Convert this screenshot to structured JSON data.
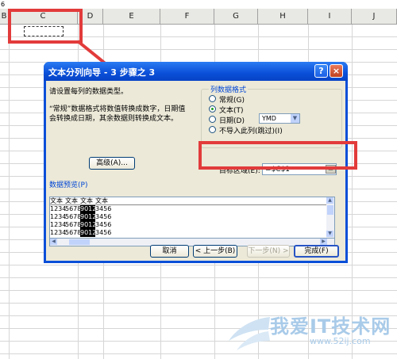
{
  "sheet": {
    "row_number": "6",
    "columns": [
      "B",
      "C",
      "D",
      "E",
      "F",
      "G",
      "H",
      "I",
      "J"
    ]
  },
  "dialog": {
    "title": "文本分列向导 - 3 步骤之 3",
    "help_label": "?",
    "close_label": "×",
    "prompt": "请设置每列的数据类型。",
    "description_line1": "“常规”数据格式将数值转换成数字，日期值",
    "description_line2": "会转换成日期，其余数据则转换成文本。",
    "advanced_button": "高级(A)...",
    "column_format": {
      "title": "列数据格式",
      "options": [
        {
          "label": "常规(G)",
          "selected": false
        },
        {
          "label": "文本(T)",
          "selected": true
        },
        {
          "label": "日期(D)",
          "selected": false
        },
        {
          "label": "不导入此列(跳过)(I)",
          "selected": false
        }
      ],
      "date_format": "YMD"
    },
    "destination": {
      "label": "目标区域(E):",
      "value": "=$C$1"
    },
    "preview": {
      "title": "数据预览(P)",
      "header_cells": [
        "文本",
        "文本",
        "文本",
        "文本"
      ],
      "rows": [
        [
          "1234",
          "5678",
          "9012",
          "3456"
        ],
        [
          "1234",
          "5678",
          "9012",
          "3456"
        ],
        [
          "1234",
          "5678",
          "9012",
          "3456"
        ],
        [
          "1234",
          "5678",
          "9012",
          "3456"
        ]
      ]
    },
    "buttons": {
      "cancel": "取消",
      "back": "< 上一步(B)",
      "next": "下一步(N) >",
      "finish": "完成(F)"
    }
  },
  "watermark": {
    "text": "我爱IT技术网",
    "url": "www.52ij.com"
  }
}
